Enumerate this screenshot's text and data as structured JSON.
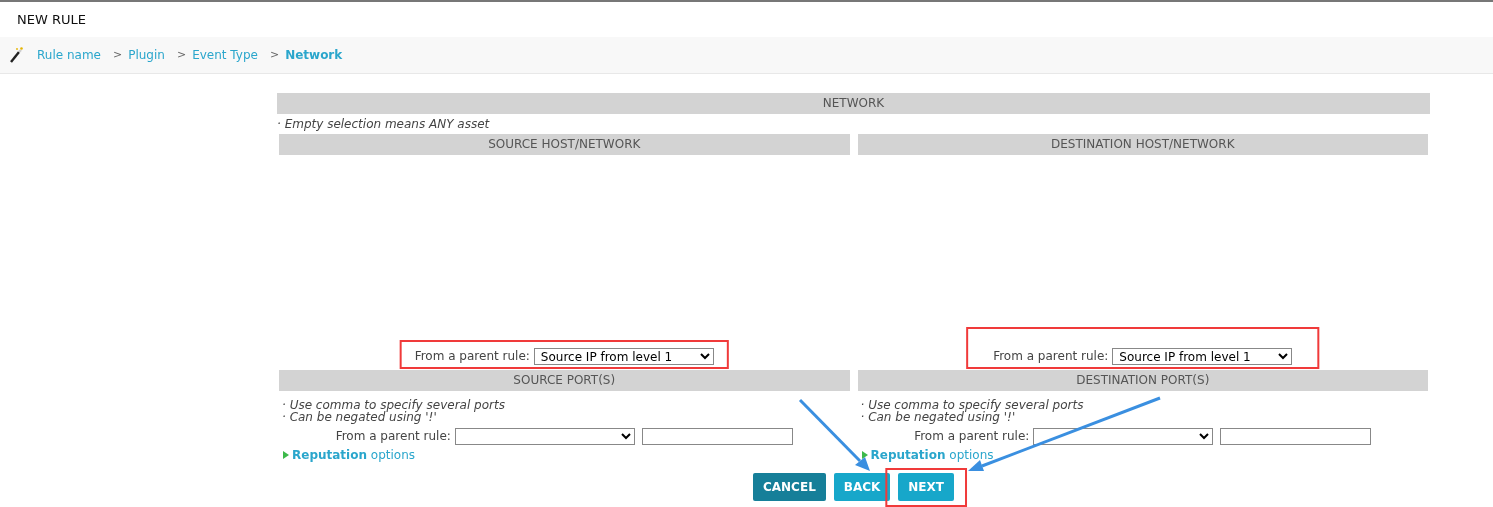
{
  "title": "NEW RULE",
  "breadcrumb": [
    {
      "label": "Rule name",
      "selected": false
    },
    {
      "separator": ">",
      "label": "Plugin",
      "selected": false
    },
    {
      "separator": ">",
      "label": "Event Type",
      "selected": false
    },
    {
      "separator": ">",
      "label": "Network",
      "selected": true
    }
  ],
  "section_title": "NETWORK",
  "note": "· Empty selection means ANY asset",
  "columns": [
    {
      "title": "SOURCE HOST/NETWORK",
      "parent_rule_label": "From a parent rule:",
      "parent_rule_value": "Source IP from level 1",
      "port_title": "SOURCE PORT(S)",
      "port_notes": [
        "· Use comma to specify several ports",
        "· Can be negated using '!'"
      ],
      "port_parent_label": "From a parent rule:",
      "reputation": "**Reputation** options",
      "reputation_expanded": false
    },
    {
      "title": "DESTINATION HOST/NETWORK",
      "parent_rule_label": "From a parent rule:",
      "parent_rule_value": "Source IP from level 1",
      "port_title": "DESTINATION PORT(S)",
      "port_notes": [
        "· Use comma to specify several ports",
        "· Can be negated using '!'"
      ],
      "port_parent_label": "From a parent rule:",
      "reputation": "**Reputation** options",
      "reputation_expanded": false
    }
  ],
  "buttons": [
    {
      "label": "CANCEL",
      "kind": "cancel"
    },
    {
      "label": "BACK",
      "kind": "back"
    },
    {
      "label": "NEXT",
      "kind": "next"
    }
  ]
}
